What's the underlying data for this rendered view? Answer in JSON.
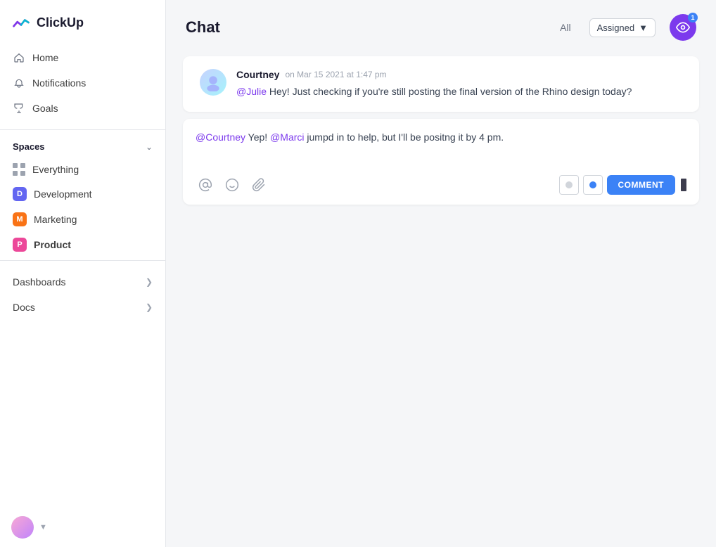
{
  "app": {
    "name": "ClickUp"
  },
  "sidebar": {
    "nav_items": [
      {
        "id": "home",
        "label": "Home",
        "icon": "home"
      },
      {
        "id": "notifications",
        "label": "Notifications",
        "icon": "bell"
      },
      {
        "id": "goals",
        "label": "Goals",
        "icon": "trophy"
      }
    ],
    "spaces_label": "Spaces",
    "spaces": [
      {
        "id": "everything",
        "label": "Everything",
        "type": "dots"
      },
      {
        "id": "development",
        "label": "Development",
        "badge": "D",
        "color": "blue"
      },
      {
        "id": "marketing",
        "label": "Marketing",
        "badge": "M",
        "color": "orange"
      },
      {
        "id": "product",
        "label": "Product",
        "badge": "P",
        "color": "pink",
        "bold": true
      }
    ],
    "bottom_items": [
      {
        "id": "dashboards",
        "label": "Dashboards"
      },
      {
        "id": "docs",
        "label": "Docs"
      }
    ]
  },
  "chat": {
    "title": "Chat",
    "filter_all": "All",
    "filter_assigned": "Assigned",
    "watch_badge": "1",
    "messages": [
      {
        "id": "msg1",
        "author": "Courtney",
        "timestamp": "on Mar 15 2021 at 1:47 pm",
        "mention": "@Julie",
        "text": " Hey! Just checking if you're still posting the final version of the Rhino design today?"
      }
    ],
    "reply": {
      "mention1": "@Courtney",
      "text1": " Yep! ",
      "mention2": "@Marci",
      "text2": " jumpd in to help, but I'll be positng it by 4 pm."
    },
    "toolbar": {
      "comment_label": "COMMENT"
    }
  }
}
